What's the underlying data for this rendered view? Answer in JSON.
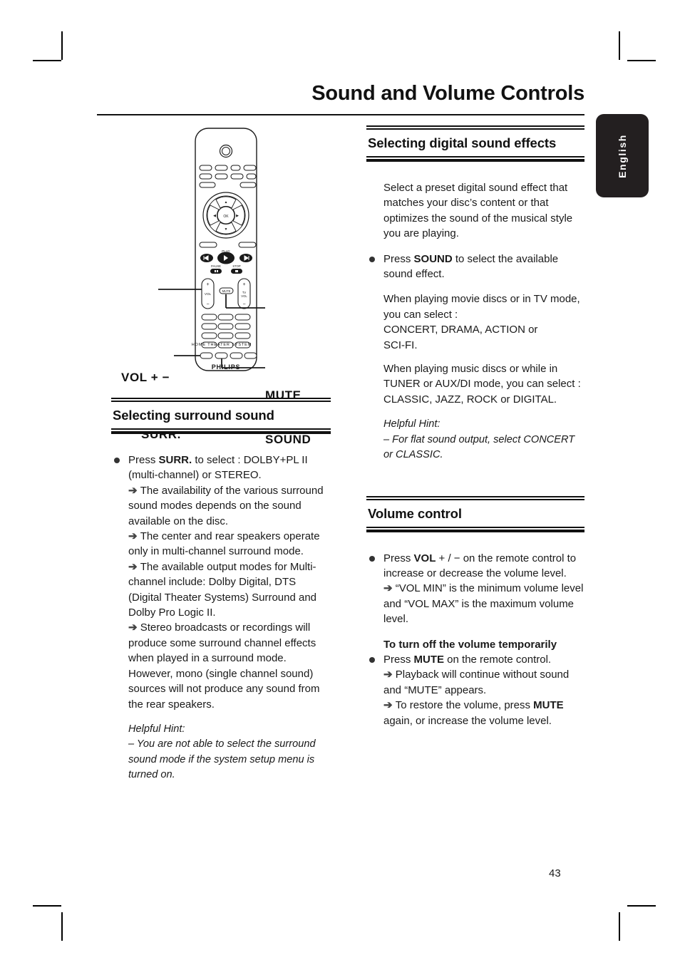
{
  "page": {
    "title": "Sound and Volume Controls",
    "number": "43",
    "language_tab": "English"
  },
  "figure": {
    "name": "remote-control-diagram",
    "brand": "PHILIPS",
    "sub_brand": "HOME THEATER SYSTEM",
    "ok_label": "OK",
    "play_label": "PLAY",
    "pause_label": "PAUSE",
    "stop_label": "STOP",
    "vol_label": "VOL",
    "tvvol_label": "TV\nVOL",
    "mute_btn_label": "MUTE",
    "callouts": [
      {
        "id": "vol",
        "label": "VOL + −"
      },
      {
        "id": "mute",
        "label": "MUTE"
      },
      {
        "id": "surr",
        "label": "SURR."
      },
      {
        "id": "sound",
        "label": "SOUND"
      }
    ]
  },
  "left_column": {
    "section": {
      "heading": "Selecting surround sound",
      "bullet_intro_a": "Press ",
      "bullet_intro_b": "SURR.",
      "bullet_intro_c": " to select : DOLBY+PL II (multi-channel) or STEREO.",
      "notes": [
        "The availability of the various surround sound modes depends on the sound available on the disc.",
        "The center and rear speakers operate only in multi-channel surround mode.",
        "The available output modes for Multi-channel include: Dolby Digital, DTS (Digital Theater Systems) Surround and Dolby Pro Logic II.",
        "Stereo broadcasts or recordings will produce some surround channel effects when played in a surround mode. However, mono (single channel sound) sources will not produce any sound from the rear speakers."
      ],
      "hint_title": "Helpful Hint:",
      "hint_body": "–  You are not able to select the surround sound mode if the system setup menu is turned on."
    }
  },
  "right_column": {
    "section_digital": {
      "heading": "Selecting digital sound effects",
      "intro": "Select a preset digital sound effect that matches your disc’s content or that optimizes the sound of the musical style you are playing.",
      "bullet_a": "Press ",
      "bullet_b": "SOUND",
      "bullet_c": " to select the available sound effect.",
      "movie_modes": "When playing movie discs or in TV mode, you can select :\nCONCERT, DRAMA, ACTION or\nSCI-FI.",
      "music_modes": "When playing music discs or while in TUNER or AUX/DI mode, you can select :\nCLASSIC, JAZZ, ROCK or DIGITAL.",
      "hint_title": "Helpful Hint:",
      "hint_body": "– For flat sound output, select CONCERT or CLASSIC."
    },
    "section_volume": {
      "heading": "Volume control",
      "bullet_a": "Press ",
      "bullet_b": "VOL",
      "bullet_c": "  + / −  on the remote control to increase or decrease the volume level.",
      "note_1": "“VOL MIN” is the minimum volume level and “VOL MAX” is the maximum volume level.",
      "subhead": "To turn off the volume temporarily",
      "mute_a": "Press ",
      "mute_b": "MUTE",
      "mute_c": " on the remote control.",
      "note_2": "Playback will continue without sound and “MUTE” appears.",
      "note_3_a": "To restore the volume, press ",
      "note_3_b": "MUTE",
      "note_3_c": " again, or increase the volume level."
    }
  },
  "colors": {
    "ink": "#1a1a1a",
    "rule": "#111111",
    "tab_bg": "#231f20",
    "tab_text": "#ffffff"
  }
}
